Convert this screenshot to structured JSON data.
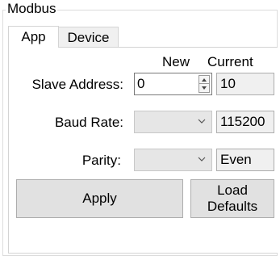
{
  "group": {
    "title": "Modbus"
  },
  "tabs": [
    {
      "label": "App",
      "selected": true
    },
    {
      "label": "Device",
      "selected": false
    }
  ],
  "columns": {
    "new": "New",
    "current": "Current"
  },
  "slave_address": {
    "label": "Slave Address:",
    "new_value": "0",
    "current_value": "10"
  },
  "baud_rate": {
    "label": "Baud Rate:",
    "new_value": "",
    "current_value": "115200"
  },
  "parity": {
    "label": "Parity:",
    "new_value": "",
    "current_value": "Even"
  },
  "buttons": {
    "apply": "Apply",
    "load_defaults_line1": "Load",
    "load_defaults_line2": "Defaults"
  },
  "icons": {
    "spinner_up": "chevron-up-icon",
    "spinner_down": "chevron-down-icon",
    "combo_arrow": "chevron-down-icon"
  }
}
